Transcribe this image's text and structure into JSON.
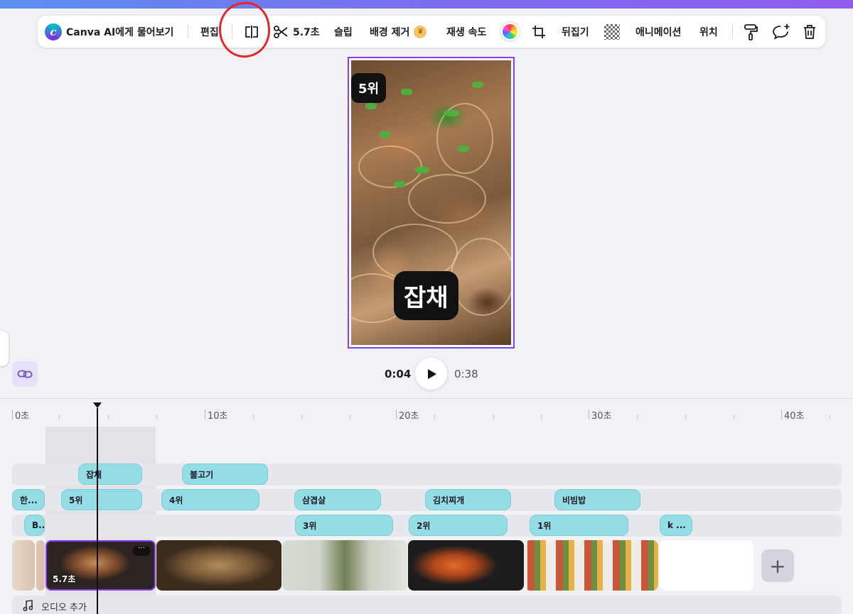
{
  "toolbar": {
    "canva_ai_label": "Canva AI에게 물어보기",
    "edit_label": "편집",
    "duration_label": "5.7초",
    "slip_label": "슬립",
    "bg_remove_label": "배경 제거",
    "speed_label": "재생 속도",
    "flip_label": "뒤집기",
    "animation_label": "애니메이션",
    "position_label": "위치"
  },
  "canvas": {
    "rank_badge": "5위",
    "dish_badge": "잡채"
  },
  "playback": {
    "current_time": "0:04",
    "total_time": "0:38"
  },
  "ruler": {
    "labels": [
      "0초",
      "10초",
      "20초",
      "30초",
      "40초"
    ]
  },
  "timeline": {
    "row1": [
      "잡채",
      "불고기"
    ],
    "row2": [
      "한...",
      "5위",
      "4위",
      "삼겹살",
      "김치찌개",
      "비빔밥"
    ],
    "row3": [
      "B...",
      "3위",
      "2위",
      "1위",
      "k ..."
    ],
    "selected_clip_duration": "5.7초",
    "selected_clip_more": "···",
    "add_clip_label": "+",
    "audio_label": "오디오 추가"
  },
  "colors": {
    "accent_purple": "#8b3dff",
    "chip_cyan": "#95dde4",
    "annotation_red": "#e3272b"
  },
  "icons": [
    "canva-logo-icon",
    "split-icon",
    "scissors-icon",
    "crown-icon",
    "color-wheel-icon",
    "crop-icon",
    "transparency-icon",
    "paint-roller-icon",
    "comment-add-icon",
    "trash-icon",
    "link-icon",
    "play-icon",
    "music-note-icon",
    "plus-icon"
  ]
}
